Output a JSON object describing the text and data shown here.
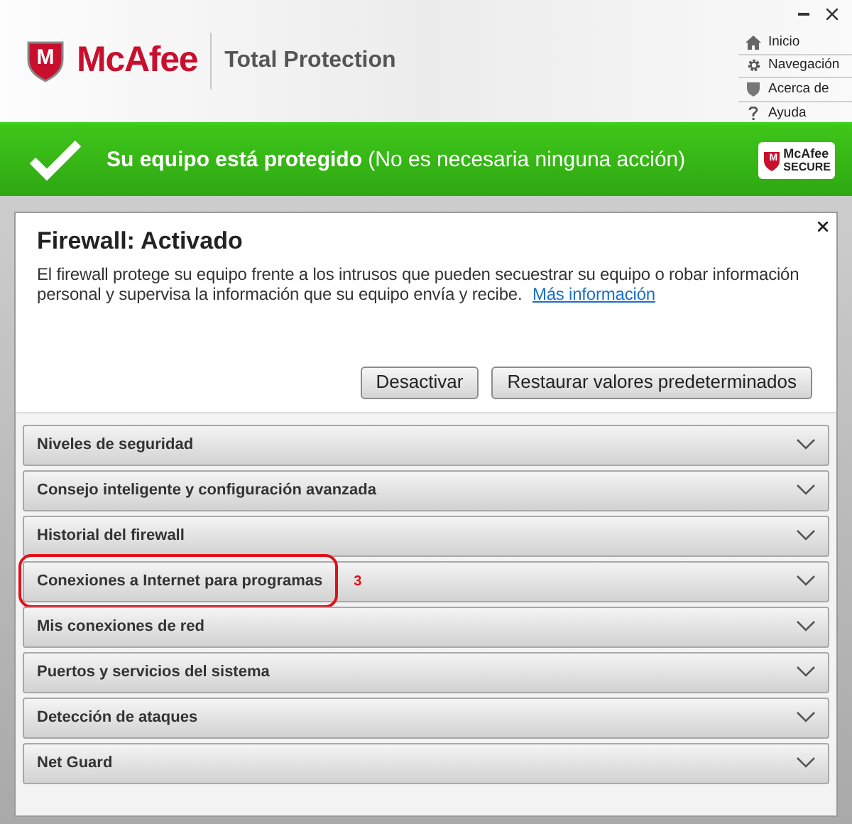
{
  "header": {
    "logo_mark": "M",
    "brand": "McAfee",
    "product": "Total Protection",
    "links": [
      {
        "kind": "home",
        "label": "Inicio"
      },
      {
        "kind": "gear",
        "label": "Navegación"
      },
      {
        "kind": "shield",
        "label": "Acerca de"
      },
      {
        "kind": "help",
        "label": "Ayuda"
      }
    ]
  },
  "status": {
    "text": "**Su equipo está protegido** (No es necesaria ninguna acción)",
    "badge_mark": "M",
    "badge_brand": "McAfee",
    "badge_label": "SECURE"
  },
  "panel": {
    "title": "Firewall: Activado",
    "description": "El firewall protege su equipo frente a los intrusos que pueden secuestrar su equipo o robar información personal y supervisa la información que su equipo envía y recibe.",
    "link": "Más información",
    "buttons": [
      "Desactivar",
      "Restaurar valores predeterminados"
    ],
    "sections": [
      {
        "label": "Niveles de seguridad",
        "expanded": false
      },
      {
        "label": "Consejo inteligente y configuración avanzada",
        "expanded": false
      },
      {
        "label": "Historial del firewall",
        "expanded": false
      },
      {
        "label": "Conexiones a Internet para programas",
        "expanded": false,
        "annotation": "3"
      },
      {
        "label": "Mis conexiones de red",
        "expanded": false
      },
      {
        "label": "Puertos y servicios del sistema",
        "expanded": false
      },
      {
        "label": "Detección de ataques",
        "expanded": false
      },
      {
        "label": "Net Guard",
        "expanded": false
      }
    ]
  }
}
